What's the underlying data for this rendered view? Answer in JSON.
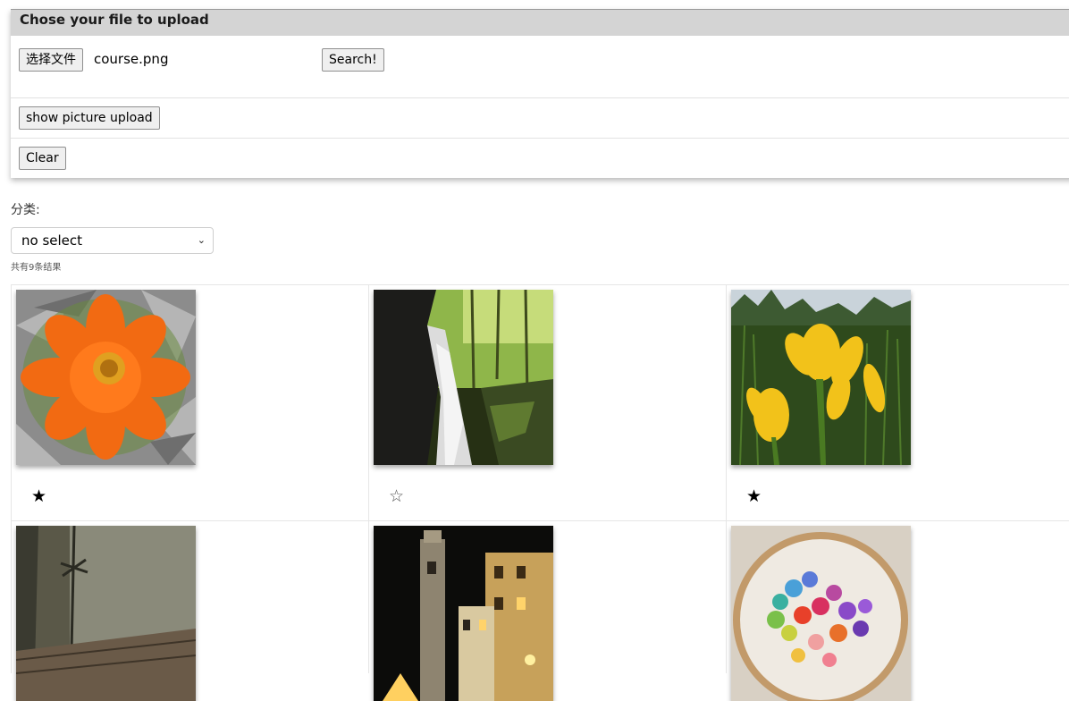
{
  "upload": {
    "header": "Chose your file to upload",
    "choose_file_label": "选择文件",
    "file_name": "course.png",
    "search_label": "Search!",
    "show_picture_label": "show picture upload",
    "clear_label": "Clear"
  },
  "filter": {
    "category_label": "分类:",
    "selected_option": "no select",
    "result_count": "共有9条结果"
  },
  "gallery": {
    "items": [
      {
        "subject": "orange flower",
        "star": "★",
        "favorited": true
      },
      {
        "subject": "waterfall",
        "star": "☆",
        "favorited": false
      },
      {
        "subject": "yellow irises",
        "star": "★",
        "favorited": true
      },
      {
        "subject": "barbed wire",
        "star": "",
        "favorited": null
      },
      {
        "subject": "night buildings",
        "star": "",
        "favorited": null
      },
      {
        "subject": "embroidery hoop",
        "star": "",
        "favorited": null
      }
    ]
  }
}
